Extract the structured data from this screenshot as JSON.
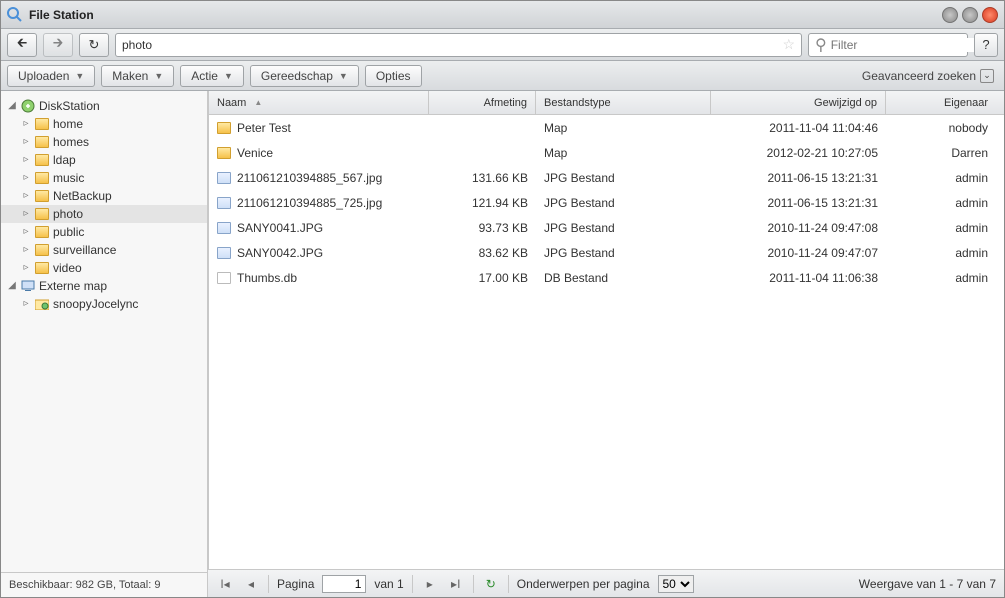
{
  "window": {
    "title": "File Station"
  },
  "nav": {
    "address_value": "photo",
    "filter_placeholder": "Filter",
    "help": "?"
  },
  "toolbar": {
    "upload": "Uploaden",
    "create": "Maken",
    "action": "Actie",
    "tools": "Gereedschap",
    "options": "Opties",
    "advanced_search": "Geavanceerd zoeken"
  },
  "tree": {
    "root1": {
      "label": "DiskStation"
    },
    "items1": [
      "home",
      "homes",
      "ldap",
      "music",
      "NetBackup",
      "photo",
      "public",
      "surveillance",
      "video"
    ],
    "root2": {
      "label": "Externe map"
    },
    "items2": [
      "snoopyJocelync"
    ],
    "selected_index": 5,
    "footer": "Beschikbaar: 982 GB, Totaal: 9"
  },
  "columns": {
    "name": "Naam",
    "size": "Afmeting",
    "type": "Bestandstype",
    "modified": "Gewijzigd op",
    "owner": "Eigenaar"
  },
  "rows": [
    {
      "kind": "folder",
      "name": "Peter Test",
      "size": "",
      "type": "Map",
      "date": "2011-11-04 11:04:46",
      "owner": "nobody"
    },
    {
      "kind": "folder",
      "name": "Venice",
      "size": "",
      "type": "Map",
      "date": "2012-02-21 10:27:05",
      "owner": "Darren"
    },
    {
      "kind": "jpg",
      "name": "211061210394885_567.jpg",
      "size": "131.66 KB",
      "type": "JPG Bestand",
      "date": "2011-06-15 13:21:31",
      "owner": "admin"
    },
    {
      "kind": "jpg",
      "name": "211061210394885_725.jpg",
      "size": "121.94 KB",
      "type": "JPG Bestand",
      "date": "2011-06-15 13:21:31",
      "owner": "admin"
    },
    {
      "kind": "jpg",
      "name": "SANY0041.JPG",
      "size": "93.73 KB",
      "type": "JPG Bestand",
      "date": "2010-11-24 09:47:08",
      "owner": "admin"
    },
    {
      "kind": "jpg",
      "name": "SANY0042.JPG",
      "size": "83.62 KB",
      "type": "JPG Bestand",
      "date": "2010-11-24 09:47:07",
      "owner": "admin"
    },
    {
      "kind": "db",
      "name": "Thumbs.db",
      "size": "17.00 KB",
      "type": "DB Bestand",
      "date": "2011-11-04 11:06:38",
      "owner": "admin"
    }
  ],
  "pager": {
    "page_label": "Pagina",
    "page_value": "1",
    "of_label": "van 1",
    "perpage_label": "Onderwerpen per pagina",
    "perpage_value": "50",
    "display": "Weergave van 1 - 7 van 7"
  }
}
